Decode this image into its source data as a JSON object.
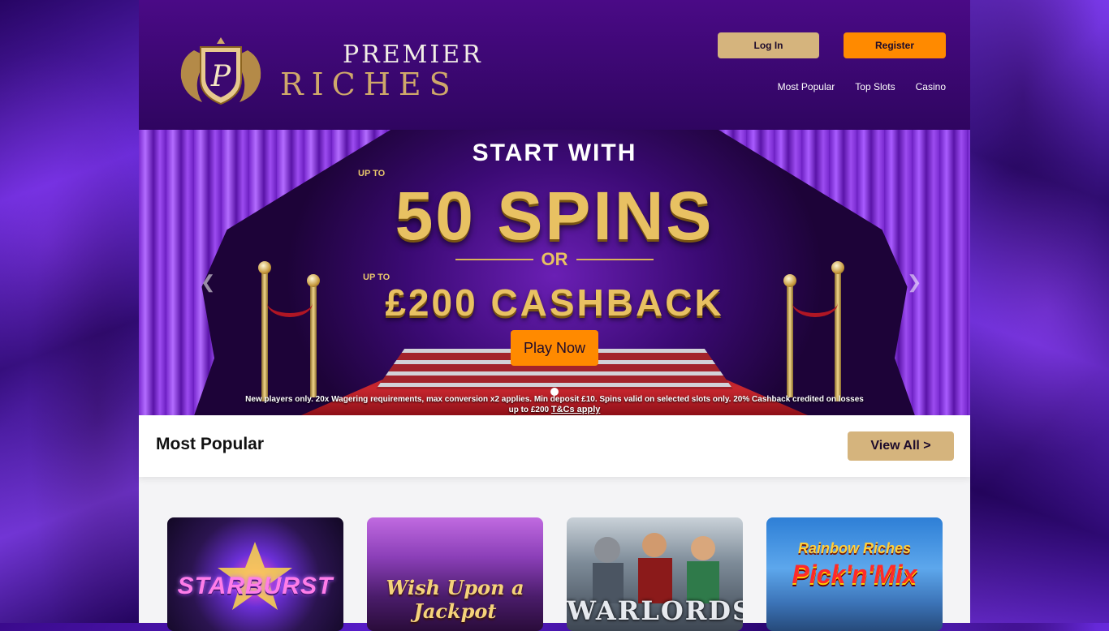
{
  "brand": {
    "word1": "PREMIER",
    "word2": "RICHES",
    "monogram": "P"
  },
  "header": {
    "login_label": "Log In",
    "register_label": "Register",
    "nav": [
      "Most Popular",
      "Top Slots",
      "Casino"
    ]
  },
  "banner": {
    "line1": "START WITH",
    "upto1": "UP TO",
    "spins": "50 SPINS",
    "or": "OR",
    "upto2": "UP TO",
    "cashback": "£200 CASHBACK",
    "cta": "Play Now",
    "terms_line1": "New players only. 20x Wagering requirements, max conversion x2 applies. Min deposit £10. Spins valid on selected slots only. 20% Cashback credited on losses",
    "terms_line2": "up to £200",
    "terms_link": "T&Cs apply",
    "prev_icon": "chevron-left-icon",
    "next_icon": "chevron-right-icon"
  },
  "popular": {
    "title": "Most Popular",
    "view_all": "View All >"
  },
  "games": [
    {
      "title": "STARBURST"
    },
    {
      "title": "Wish Upon a Jackpot"
    },
    {
      "title": "WARLORDS"
    },
    {
      "title_top": "Rainbow Riches",
      "title_bottom": "Pick'n'Mix"
    }
  ],
  "colors": {
    "header_bg": "#3b0870",
    "gold": "#d5b47d",
    "orange": "#ff8a00",
    "background_silk": "#4a14b0"
  }
}
